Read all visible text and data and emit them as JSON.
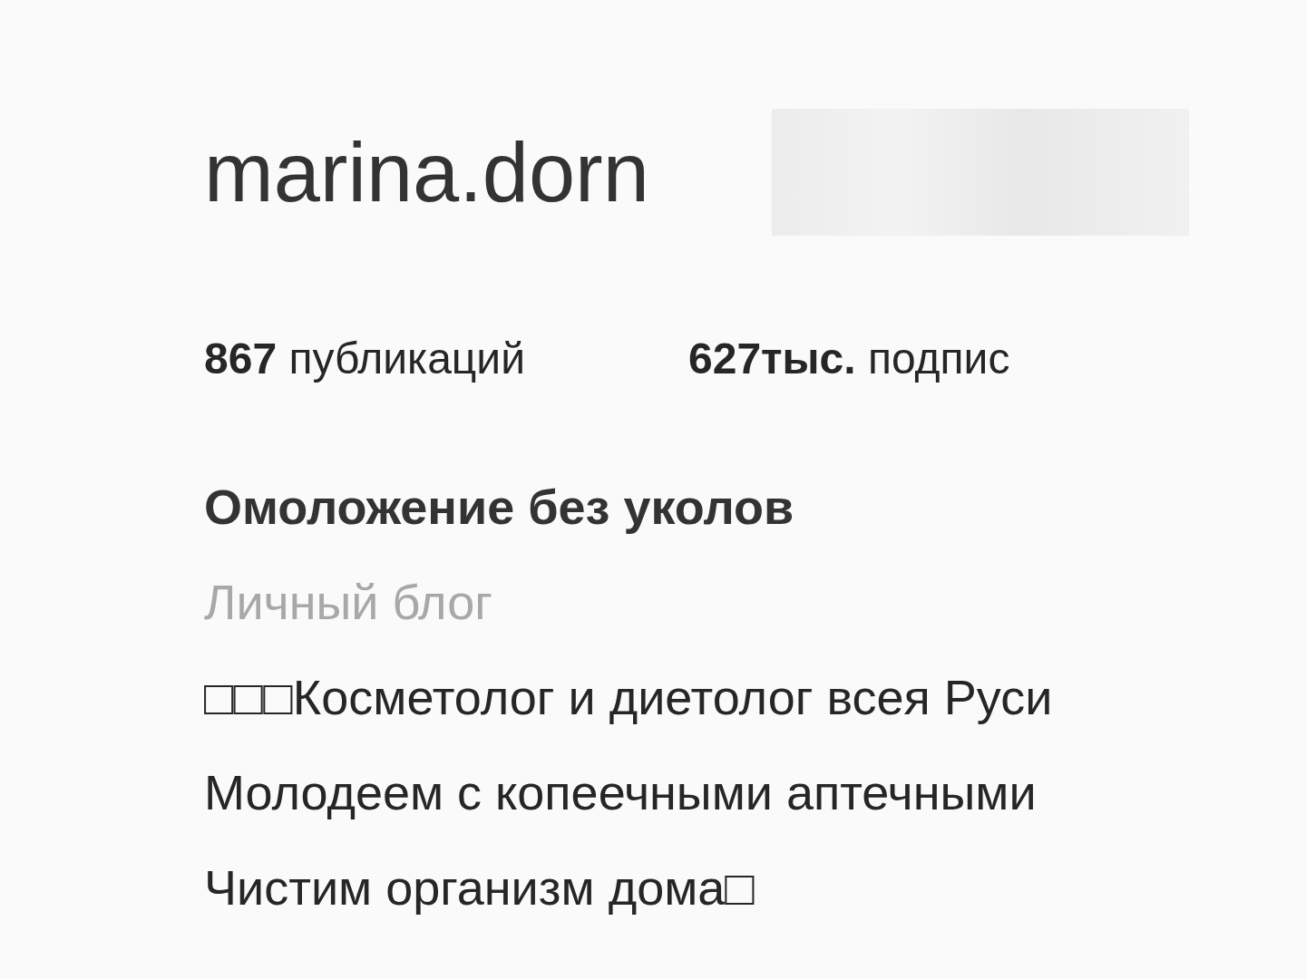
{
  "profile": {
    "username": "marina.dorn",
    "stats": [
      "**867** публикаций",
      "**627тыс.** подпис"
    ],
    "name": "Омоложение без уколов",
    "category": "Личный блог",
    "bio_lines": [
      "□□□Косметолог и диетолог всея Руси",
      "Молодеем с копеечными аптечными",
      "Чистим организм дома□"
    ]
  }
}
